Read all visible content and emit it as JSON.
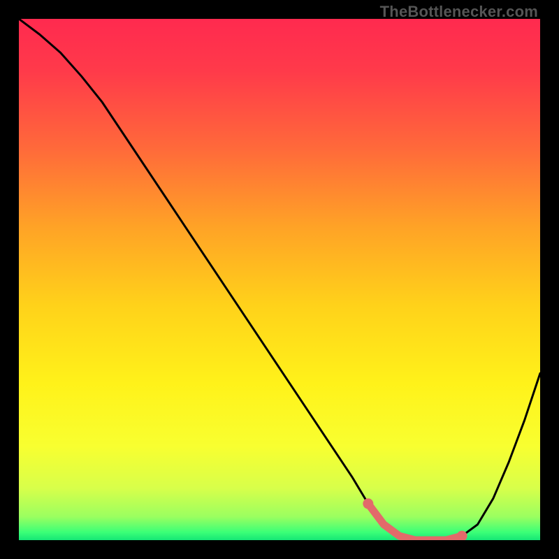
{
  "attribution": "TheBottlenecker.com",
  "chart_data": {
    "type": "line",
    "title": "",
    "xlabel": "",
    "ylabel": "",
    "xlim": [
      0,
      100
    ],
    "ylim": [
      0,
      100
    ],
    "series": [
      {
        "name": "curve",
        "x": [
          0,
          4,
          8,
          12,
          16,
          20,
          24,
          28,
          32,
          36,
          40,
          44,
          48,
          52,
          56,
          60,
          64,
          67,
          70,
          73,
          76,
          79,
          82,
          85,
          88,
          91,
          94,
          97,
          100
        ],
        "y": [
          100,
          97,
          93.5,
          89,
          84,
          78,
          72,
          66,
          60,
          54,
          48,
          42,
          36,
          30,
          24,
          18,
          12,
          7,
          3,
          0.8,
          0.0,
          0.0,
          0.0,
          0.8,
          3,
          8,
          15,
          23,
          32
        ]
      },
      {
        "name": "highlight",
        "x": [
          67,
          70,
          73,
          76,
          79,
          82,
          85
        ],
        "y": [
          7,
          3,
          0.8,
          0.0,
          0.0,
          0.0,
          0.8
        ]
      }
    ],
    "gradient_stops": [
      {
        "offset": 0.0,
        "color": "#ff2a4f"
      },
      {
        "offset": 0.1,
        "color": "#ff3a4a"
      },
      {
        "offset": 0.25,
        "color": "#ff6a3a"
      },
      {
        "offset": 0.4,
        "color": "#ffa326"
      },
      {
        "offset": 0.55,
        "color": "#ffd21a"
      },
      {
        "offset": 0.7,
        "color": "#fff21a"
      },
      {
        "offset": 0.82,
        "color": "#f8ff30"
      },
      {
        "offset": 0.9,
        "color": "#d8ff4a"
      },
      {
        "offset": 0.955,
        "color": "#9bff60"
      },
      {
        "offset": 0.985,
        "color": "#3bff77"
      },
      {
        "offset": 1.0,
        "color": "#15e676"
      }
    ],
    "highlight_color": "#e26a6a",
    "curve_color": "#000000"
  }
}
